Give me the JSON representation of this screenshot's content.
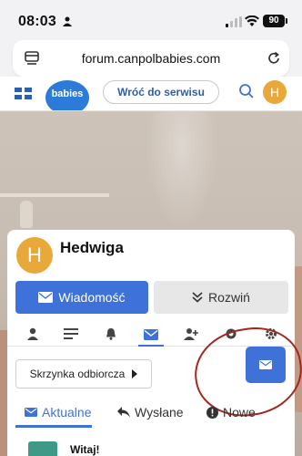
{
  "status_bar": {
    "time": "08:03",
    "battery": "90"
  },
  "browser": {
    "url": "forum.canpolbabies.com"
  },
  "site_header": {
    "logo_text": "babies",
    "back_button": "Wróć do serwisu",
    "avatar_letter": "H"
  },
  "profile": {
    "avatar_letter": "H",
    "name": "Hedwiga",
    "message_button": "Wiadomość",
    "expand_button": "Rozwiń"
  },
  "icon_tabs": [
    "person-icon",
    "list-icon",
    "bell-icon",
    "envelope-icon",
    "add-user-icon",
    "badge-icon",
    "gear-icon"
  ],
  "inbox": {
    "folder_select": "Skrzynka odbiorcza",
    "tabs": [
      {
        "label": "Aktualne"
      },
      {
        "label": "Wysłane"
      },
      {
        "label": "Nowe"
      }
    ],
    "first_message_title": "Witaj!"
  },
  "colors": {
    "accent": "#3f72d9",
    "avatar": "#e8a93a",
    "annotation": "#a3271f"
  }
}
